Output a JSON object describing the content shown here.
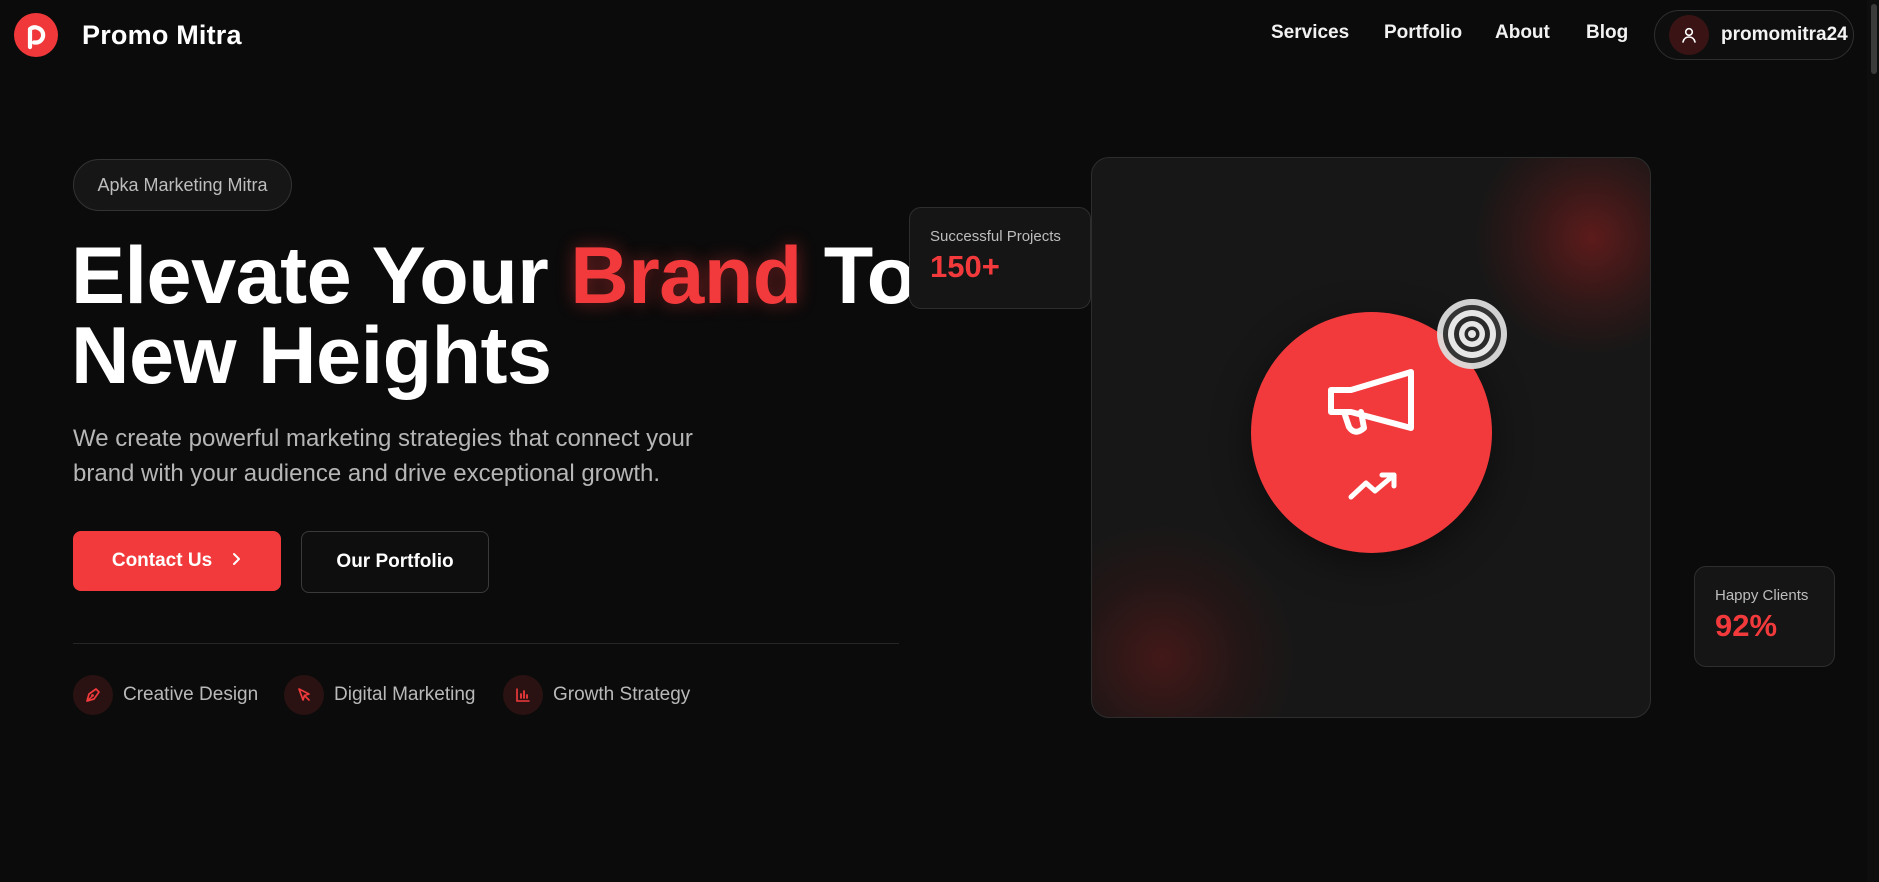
{
  "brand": {
    "name": "Promo Mitra",
    "logo_letter_icon": "p-logo-icon"
  },
  "nav": {
    "links": [
      "Services",
      "Portfolio",
      "About",
      "Blog"
    ],
    "user": {
      "name": "promomitra24",
      "icon": "user-icon"
    }
  },
  "hero": {
    "tagline": "Apka Marketing Mitra",
    "headline": {
      "part1": "Elevate Your ",
      "accent": "Brand",
      "part2": " To",
      "line2": "New Heights"
    },
    "subtext": "We create powerful marketing strategies that connect your brand with your audience and drive exceptional growth.",
    "primary_button": "Contact Us",
    "secondary_button": "Our Portfolio",
    "features": [
      {
        "label": "Creative Design",
        "icon": "pen-tool-icon"
      },
      {
        "label": "Digital Marketing",
        "icon": "cursor-click-icon"
      },
      {
        "label": "Growth Strategy",
        "icon": "bar-chart-icon"
      }
    ]
  },
  "stats": [
    {
      "label": "Successful Projects",
      "value": "150+"
    },
    {
      "label": "Happy Clients",
      "value": "92%"
    }
  ],
  "visual": {
    "icons": [
      "megaphone-icon",
      "trending-up-icon",
      "target-icon"
    ]
  },
  "colors": {
    "accent": "#f23a3c",
    "background": "#0b0b0b",
    "card": "#171717"
  }
}
